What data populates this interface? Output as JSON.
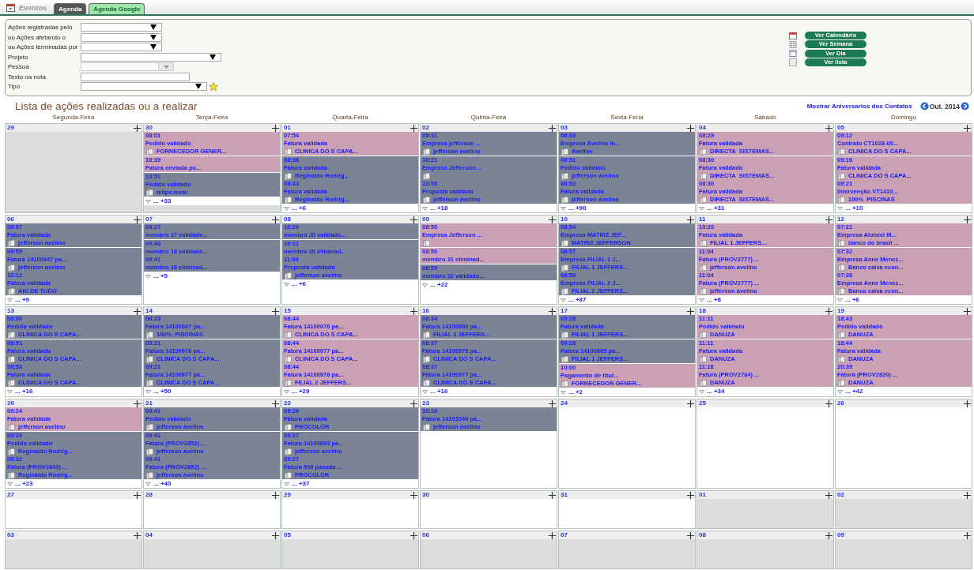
{
  "header": {
    "section_title": "Eventos",
    "tabs": [
      {
        "label": "Agenda",
        "selected": true
      },
      {
        "label": "Agenda Google",
        "selected": false
      }
    ]
  },
  "filters": [
    {
      "label": "Ações registradas pelo",
      "kind": "short-select"
    },
    {
      "label": "ou Ações afetando o",
      "kind": "short-select"
    },
    {
      "label": "ou Ações terminadas por",
      "kind": "short-select"
    },
    {
      "label": "Projeto",
      "kind": "long-select"
    },
    {
      "label": "Pessoa",
      "kind": "combo",
      "disabled": true
    },
    {
      "label": "Texto na nota",
      "kind": "text"
    },
    {
      "label": "Tipo",
      "kind": "medium-select",
      "star": true
    }
  ],
  "view_buttons": [
    {
      "label": "Ver Calendário",
      "kind": "calendar"
    },
    {
      "label": "Ver Semana",
      "kind": "week"
    },
    {
      "label": "Ver Dia",
      "kind": "day"
    },
    {
      "label": "Ver lista",
      "kind": "list"
    }
  ],
  "title": "Lista de ações realizadas ou a realizar",
  "birthdays_link": "Mostrar Aniversarios dos Contatos",
  "month": "Out. 2014",
  "weekdays": [
    "Segunda-Feira",
    "Terça-Feira",
    "Quarta-Feira",
    "Quinta-Feira",
    "Sexta-Feria",
    "Sábado",
    "Domingo"
  ],
  "weeks": [
    {
      "days": [
        {
          "day": "29",
          "other_month": true
        },
        {
          "day": "30",
          "other_month": true,
          "more": "... +33",
          "groups": [
            {
              "color": "#c9a0b4",
              "events": [
                {
                  "time": "08:01",
                  "title": "Pedido validado",
                  "card_icon": true,
                  "contact": "FORNECEDOR GENER..."
                }
              ]
            },
            {
              "color": "#c9a0b4",
              "events": [
                {
                  "time": "10:39",
                  "title": "Fatura enviada po...",
                  "card_icon": false
                }
              ]
            },
            {
              "color": "#7a8496",
              "events": [
                {
                  "time": "13:51",
                  "title": "Pedido validado",
                  "card_icon": true,
                  "contact": "felipe.teste"
                }
              ]
            }
          ]
        },
        {
          "day": "01",
          "other_month": false,
          "more": "... +6",
          "groups": [
            {
              "color": "#c9a0b4",
              "events": [
                {
                  "time": "07:54",
                  "title": "Fatura validada",
                  "card_icon": true,
                  "contact": "CLINICA DO S CAPA..."
                }
              ]
            },
            {
              "color": "#7a8496",
              "events": [
                {
                  "time": "08:38",
                  "title": "Fatura validada",
                  "card_icon": true,
                  "contact": "Reginaldo Rodrig..."
                },
                {
                  "time": "08:43",
                  "title": "Fatura validada",
                  "card_icon": true,
                  "contact": "Reginaldo Rodrig..."
                }
              ]
            }
          ]
        },
        {
          "day": "02",
          "other_month": false,
          "more": "... +18",
          "groups": [
            {
              "color": "#7a8496",
              "events": [
                {
                  "time": "09:31",
                  "title": "Empresa jefferson ...",
                  "card_icon": true,
                  "contact": "jefferson avelino"
                }
              ]
            },
            {
              "color": "#7a8496",
              "events": [
                {
                  "time": "10:21",
                  "title": "Empresa Jefferson ...",
                  "card_icon": true
                },
                {
                  "time": "10:58",
                  "title": "Proposta validada",
                  "card_icon": true,
                  "contact": "jefferson avelino"
                }
              ]
            }
          ]
        },
        {
          "day": "03",
          "other_month": false,
          "more": "... +90",
          "groups": [
            {
              "color": "#7a8496",
              "events": [
                {
                  "time": "08:33",
                  "title": "Empresa Avelino In...",
                  "card_icon": true,
                  "contact": "Avelino"
                }
              ]
            },
            {
              "color": "#7a8496",
              "events": [
                {
                  "time": "08:51",
                  "title": "Pedido validado",
                  "card_icon": true,
                  "contact": "jefferson avelino"
                },
                {
                  "time": "08:53",
                  "title": "Fatura validada",
                  "card_icon": true,
                  "contact": "jefferson avelino"
                }
              ]
            }
          ]
        },
        {
          "day": "04",
          "other_month": false,
          "more": "... +31",
          "groups": [
            {
              "color": "#c9a0b4",
              "events": [
                {
                  "time": "08:29",
                  "title": "Fatura validada",
                  "card_icon": true,
                  "contact": "DIRECTA  SISTEMAS..."
                }
              ]
            },
            {
              "color": "#c9a0b4",
              "events": [
                {
                  "time": "08:30",
                  "title": "Fatura validada",
                  "card_icon": true,
                  "contact": "DIRECTA  SISTEMAS..."
                },
                {
                  "time": "08:30",
                  "title": "Fatura validada",
                  "card_icon": true,
                  "contact": "DIRECTA  SISTEMAS..."
                }
              ]
            }
          ]
        },
        {
          "day": "05",
          "other_month": false,
          "more": "... +10",
          "groups": [
            {
              "color": "#c9a0b4",
              "events": [
                {
                  "time": "09:12",
                  "title": "Contrato CT1028-00...",
                  "card_icon": true,
                  "contact": "CLINICA DO S CAPA..."
                }
              ]
            },
            {
              "color": "#c9a0b4",
              "events": [
                {
                  "time": "09:16",
                  "title": "Fatura validada",
                  "card_icon": true,
                  "contact": "CLINICA DO S CAPA..."
                },
                {
                  "time": "09:21",
                  "title": "Intervenção VT1410...",
                  "card_icon": true,
                  "contact": "100%  PISCINAS"
                }
              ]
            }
          ]
        }
      ]
    },
    {
      "days": [
        {
          "day": "06",
          "other_month": false,
          "more": "... +9",
          "groups": [
            {
              "color": "#7a8496",
              "events": [
                {
                  "time": "08:57",
                  "title": "Fatura validada",
                  "card_icon": true,
                  "contact": "jefferson avelino"
                }
              ]
            },
            {
              "color": "#7a8496",
              "events": [
                {
                  "time": "09:59",
                  "title": "Fatura 14100947 pa...",
                  "card_icon": true,
                  "contact": "jefferson avelino"
                },
                {
                  "time": "10:12",
                  "title": "Fatura validada",
                  "card_icon": true,
                  "contact": "AKI DE TUDO"
                }
              ]
            }
          ]
        },
        {
          "day": "07",
          "other_month": false,
          "more": "... +5",
          "groups": [
            {
              "color": "#7a8496",
              "events": [
                {
                  "time": "09:27",
                  "title": "membro 17 validado...",
                  "card_icon": false
                }
              ]
            },
            {
              "color": "#7a8496",
              "events": [
                {
                  "time": "09:40",
                  "title": "membro 18 validado...",
                  "card_icon": false
                },
                {
                  "time": "09:41",
                  "title": "membro 18 eliminad...",
                  "card_icon": false
                }
              ]
            }
          ]
        },
        {
          "day": "08",
          "other_month": false,
          "more": "... +6",
          "groups": [
            {
              "color": "#7a8496",
              "events": [
                {
                  "time": "10:29",
                  "title": "membro 20 validado...",
                  "card_icon": false
                }
              ]
            },
            {
              "color": "#7a8496",
              "events": [
                {
                  "time": "10:31",
                  "title": "membro 20 eliminad...",
                  "card_icon": false
                },
                {
                  "time": "11:04",
                  "title": "Proposta validada",
                  "card_icon": true,
                  "contact": "jefferson avelino"
                }
              ]
            }
          ]
        },
        {
          "day": "09",
          "other_month": false,
          "more": "... +22",
          "groups": [
            {
              "color": "#c9a0b4",
              "events": [
                {
                  "time": "08:50",
                  "title": "Empresa Jefferson ...",
                  "card_icon": true
                }
              ]
            },
            {
              "color": "#c9a0b4",
              "events": [
                {
                  "time": "08:50",
                  "title": "membro 21 eliminad...",
                  "card_icon": false
                }
              ]
            },
            {
              "color": "#7a8496",
              "events": [
                {
                  "time": "08:59",
                  "title": "membro 22 validado...",
                  "card_icon": false
                }
              ]
            }
          ]
        },
        {
          "day": "10",
          "other_month": false,
          "more": "... +87",
          "groups": [
            {
              "color": "#7a8496",
              "events": [
                {
                  "time": "08:54",
                  "title": "Empresa MATRIZ JEF...",
                  "card_icon": true,
                  "contact": "MATRIZ JEFFERSON"
                }
              ]
            },
            {
              "color": "#7a8496",
              "events": [
                {
                  "time": "08:57",
                  "title": "Empresa FILIAL 1 J...",
                  "card_icon": true,
                  "contact": "FILIAL 1 JEFFERS..."
                },
                {
                  "time": "08:59",
                  "title": "Empresa FILIAL 2 J...",
                  "card_icon": true,
                  "contact": "FILIAL 2 JEFFERS..."
                }
              ]
            }
          ]
        },
        {
          "day": "11",
          "other_month": false,
          "more": "... +8",
          "groups": [
            {
              "color": "#c9a0b4",
              "events": [
                {
                  "time": "10:20",
                  "title": "Fatura validada",
                  "card_icon": true,
                  "contact": "FILIAL 1 JEFFERS..."
                }
              ]
            },
            {
              "color": "#c9a0b4",
              "events": [
                {
                  "time": "11:04",
                  "title": "Fatura (PROV2777) ...",
                  "card_icon": true,
                  "contact": "jefferson avelino"
                },
                {
                  "time": "11:04",
                  "title": "Fatura (PROV2777) ...",
                  "card_icon": true,
                  "contact": "jefferson avelino"
                }
              ]
            }
          ]
        },
        {
          "day": "12",
          "other_month": false,
          "more": "... +6",
          "groups": [
            {
              "color": "#c9a0b4",
              "events": [
                {
                  "time": "07:21",
                  "title": "Empresa Aloisiel M...",
                  "card_icon": true,
                  "contact": "banco do brasil ..."
                }
              ]
            },
            {
              "color": "#c9a0b4",
              "events": [
                {
                  "time": "07:32",
                  "title": "Empresa Anne Menez...",
                  "card_icon": true,
                  "contact": "Banco caixa econ..."
                },
                {
                  "time": "07:38",
                  "title": "Empresa Anne Menez...",
                  "card_icon": true,
                  "contact": "Banco caixa econ..."
                }
              ]
            }
          ]
        }
      ]
    },
    {
      "days": [
        {
          "day": "13",
          "other_month": false,
          "more": "... +16",
          "groups": [
            {
              "color": "#7a8496",
              "events": [
                {
                  "time": "08:50",
                  "title": "Pedido validado",
                  "card_icon": true,
                  "contact": "CLINICA DO S CAPA..."
                }
              ]
            },
            {
              "color": "#7a8496",
              "events": [
                {
                  "time": "08:51",
                  "title": "Fatura validada",
                  "card_icon": true,
                  "contact": "CLINICA DO S CAPA..."
                },
                {
                  "time": "08:53",
                  "title": "Fatura validada",
                  "card_icon": true,
                  "contact": "CLINICA DO S CAPA..."
                }
              ]
            }
          ]
        },
        {
          "day": "14",
          "other_month": false,
          "more": "... +50",
          "groups": [
            {
              "color": "#7a8496",
              "events": [
                {
                  "time": "08:23",
                  "title": "Fatura 14100967 pa...",
                  "card_icon": true,
                  "contact": "100%  PISCINAS"
                }
              ]
            },
            {
              "color": "#7a8496",
              "events": [
                {
                  "time": "09:21",
                  "title": "Fatura 14100976 pa...",
                  "card_icon": true,
                  "contact": "CLINICA DO S CAPA..."
                },
                {
                  "time": "09:21",
                  "title": "Fatura 14100977 pa...",
                  "card_icon": true,
                  "contact": "CLINICA DO S CAPA..."
                }
              ]
            }
          ]
        },
        {
          "day": "15",
          "other_month": false,
          "more": "... +29",
          "groups": [
            {
              "color": "#c9a0b4",
              "events": [
                {
                  "time": "08:44",
                  "title": "Fatura 14100976 pa...",
                  "card_icon": true,
                  "contact": "CLINICA DO S CAPA..."
                }
              ]
            },
            {
              "color": "#c9a0b4",
              "events": [
                {
                  "time": "08:44",
                  "title": "Fatura 14100977 pa...",
                  "card_icon": true,
                  "contact": "CLINICA DO S CAPA..."
                },
                {
                  "time": "08:44",
                  "title": "Fatura 14100978 pa...",
                  "card_icon": true,
                  "contact": "FILIAL 2 JEFFERS..."
                }
              ]
            }
          ]
        },
        {
          "day": "16",
          "other_month": false,
          "more": "... +16",
          "groups": [
            {
              "color": "#7a8496",
              "events": [
                {
                  "time": "08:34",
                  "title": "Fatura 14100880 pa...",
                  "card_icon": true,
                  "contact": "FILIAL 1 JEFFERS..."
                }
              ]
            },
            {
              "color": "#7a8496",
              "events": [
                {
                  "time": "08:37",
                  "title": "Fatura 14100976 pa...",
                  "card_icon": true,
                  "contact": "CLINICA DO S CAPA..."
                },
                {
                  "time": "08:37",
                  "title": "Fatura 14100977 pa...",
                  "card_icon": true,
                  "contact": "CLINICA DO S CAPA..."
                }
              ]
            }
          ]
        },
        {
          "day": "17",
          "other_month": false,
          "more": "... +2",
          "groups": [
            {
              "color": "#7a8496",
              "events": [
                {
                  "time": "09:28",
                  "title": "Fatura validada",
                  "card_icon": true,
                  "contact": "FILIAL 1 JEFFERS..."
                }
              ]
            },
            {
              "color": "#7a8496",
              "events": [
                {
                  "time": "09:28",
                  "title": "Fatura 14100885 pa...",
                  "card_icon": true,
                  "contact": "FILIAL 1 JEFFERS..."
                }
              ]
            },
            {
              "color": "#c9a0b4",
              "events": [
                {
                  "time": "10:00",
                  "title": "Pagamento de titul...",
                  "card_icon": true,
                  "contact": "FORNECEDOR GENER..."
                }
              ]
            }
          ]
        },
        {
          "day": "18",
          "other_month": false,
          "more": "... +34",
          "groups": [
            {
              "color": "#c9a0b4",
              "events": [
                {
                  "time": "11:11",
                  "title": "Pedido validado",
                  "card_icon": true,
                  "contact": "DANUZA"
                }
              ]
            },
            {
              "color": "#c9a0b4",
              "events": [
                {
                  "time": "11:11",
                  "title": "Fatura validada",
                  "card_icon": true,
                  "contact": "DANUZA"
                },
                {
                  "time": "11:16",
                  "title": "Fatura (PROV2784) ...",
                  "card_icon": true,
                  "contact": "DANUZA"
                }
              ]
            }
          ]
        },
        {
          "day": "19",
          "other_month": false,
          "more": "... +42",
          "groups": [
            {
              "color": "#c9a0b4",
              "events": [
                {
                  "time": "18:43",
                  "title": "Pedido validado",
                  "card_icon": true,
                  "contact": "DANUZA"
                }
              ]
            },
            {
              "color": "#c9a0b4",
              "events": [
                {
                  "time": "18:44",
                  "title": "Fatura validada",
                  "card_icon": true,
                  "contact": "DANUZA"
                },
                {
                  "time": "20:39",
                  "title": "Fatura (PROV2820) ...",
                  "card_icon": true,
                  "contact": "DANUZA"
                }
              ]
            }
          ]
        }
      ]
    },
    {
      "days": [
        {
          "day": "20",
          "other_month": false,
          "more": "... +23",
          "groups": [
            {
              "color": "#c9a0b4",
              "events": [
                {
                  "time": "09:24",
                  "title": "Fatura validada",
                  "card_icon": true,
                  "contact": "jefferson avelino"
                }
              ]
            },
            {
              "color": "#7a8496",
              "events": [
                {
                  "time": "09:30",
                  "title": "Pedido validado",
                  "card_icon": true,
                  "contact": "Reginaldo Rodrig..."
                },
                {
                  "time": "09:32",
                  "title": "Fatura (PROV2843) ...",
                  "card_icon": true,
                  "contact": "Reginaldo Rodrig..."
                }
              ]
            }
          ]
        },
        {
          "day": "21",
          "other_month": false,
          "more": "... +40",
          "groups": [
            {
              "color": "#7a8496",
              "events": [
                {
                  "time": "09:41",
                  "title": "Pedido validado",
                  "card_icon": true,
                  "contact": "jefferson avelino"
                }
              ]
            },
            {
              "color": "#7a8496",
              "events": [
                {
                  "time": "09:41",
                  "title": "Fatura (PROV2852) ...",
                  "card_icon": true,
                  "contact": "jefferson avelino"
                },
                {
                  "time": "09:41",
                  "title": "Fatura (PROV2852) ...",
                  "card_icon": true,
                  "contact": "jefferson avelino"
                }
              ]
            }
          ]
        },
        {
          "day": "22",
          "other_month": false,
          "more": "... +37",
          "groups": [
            {
              "color": "#7a8496",
              "events": [
                {
                  "time": "09:26",
                  "title": "Fatura validada",
                  "card_icon": true,
                  "contact": "PROCOLOR"
                }
              ]
            },
            {
              "color": "#7a8496",
              "events": [
                {
                  "time": "09:27",
                  "title": "Fatura 14100893 pa...",
                  "card_icon": true,
                  "contact": "jefferson avelino"
                },
                {
                  "time": "09:27",
                  "title": "Fatura 506 pasada ...",
                  "card_icon": true,
                  "contact": "PROCOLOR"
                }
              ]
            }
          ]
        },
        {
          "day": "23",
          "other_month": false,
          "groups": [
            {
              "color": "#7a8496",
              "events": [
                {
                  "time": "10:16",
                  "title": "Fatura 14101046 pa...",
                  "card_icon": true,
                  "contact": "jefferson avelino"
                }
              ]
            }
          ]
        },
        {
          "day": "24",
          "other_month": false
        },
        {
          "day": "25",
          "other_month": false
        },
        {
          "day": "26",
          "other_month": false
        }
      ]
    },
    {
      "days": [
        {
          "day": "27",
          "other_month": false
        },
        {
          "day": "28",
          "other_month": false
        },
        {
          "day": "29",
          "other_month": false
        },
        {
          "day": "30",
          "other_month": false
        },
        {
          "day": "31",
          "other_month": false
        },
        {
          "day": "01",
          "other_month": true
        },
        {
          "day": "02",
          "other_month": true
        }
      ]
    },
    {
      "days": [
        {
          "day": "03",
          "other_month": true
        },
        {
          "day": "04",
          "other_month": true
        },
        {
          "day": "05",
          "other_month": true
        },
        {
          "day": "06",
          "other_month": true
        },
        {
          "day": "07",
          "other_month": true
        },
        {
          "day": "08",
          "other_month": true
        },
        {
          "day": "09",
          "other_month": true
        }
      ]
    }
  ]
}
